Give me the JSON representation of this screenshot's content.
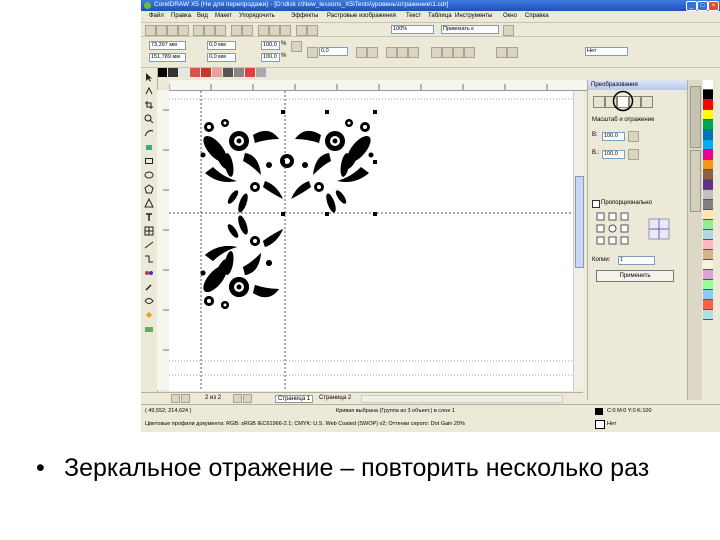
{
  "window": {
    "title": "CorelDRAW X5 (Не для перепродажи) - [D:\\disk c\\New_lessons_X5\\Tests\\уровень\\отражение\\1.cdr]",
    "controls": [
      "_",
      "□",
      "×"
    ]
  },
  "menu": [
    "Файл",
    "Правка",
    "Вид",
    "Макет",
    "Упорядочить",
    "Эффекты",
    "Растровые изображения",
    "Текст",
    "Таблица",
    "Инструменты",
    "Окно",
    "Справка"
  ],
  "toolbar": {
    "zoom": "100%",
    "snap": "Привязать к",
    "units": "мм"
  },
  "propbar": {
    "x": "73,397 мм",
    "y": "151,789 мм",
    "w": "0,0 мм",
    "h": "0,0 мм",
    "sx": "100,0",
    "sy": "100,0",
    "pct1": "%",
    "pct2": "%",
    "angle": "0,0",
    "outline": "Нет"
  },
  "page_nav": {
    "label": "2 из 2",
    "page": "Страница 1",
    "page2": "Страница 2"
  },
  "status": {
    "coords": "( 49,552; 214,624 )",
    "message": "Кривая выбрана (Группа из 3 объект.) в слое 1",
    "profile": "Цветовые профили документа: RGB: sRGB IEC61966-2.1; CMYK: U.S. Web Coated (SWOP) v2; Оттенки серого: Dot Gain 20%",
    "fill": "C:0 M:0 Y:0 K:100",
    "outline": "Нет"
  },
  "docker": {
    "title": "Преобразования",
    "mirror_label": "Масштаб и отражение",
    "w_label": "В:",
    "h_label": "В.:",
    "w_value": "100,0",
    "h_value": "100,0",
    "proportional": "Пропорционально",
    "copies_label": "Копии:",
    "copies_value": "1",
    "apply": "Применить"
  },
  "palette_colors": [
    "#ffffff",
    "#000000",
    "#ff0000",
    "#ffff00",
    "#00a651",
    "#0072bc",
    "#00aeef",
    "#ec008c",
    "#f7941d",
    "#8c6239",
    "#662d91",
    "#c0c0c0",
    "#808080",
    "#ffe4b5",
    "#90ee90",
    "#add8e6",
    "#ffb6c1",
    "#d2b48c",
    "#f5f5dc",
    "#dda0dd",
    "#98fb98",
    "#87cefa",
    "#ff6347",
    "#b0e0e6"
  ],
  "caption": {
    "bullet": "•",
    "text": "Зеркальное отражение – повторить несколько раз"
  }
}
